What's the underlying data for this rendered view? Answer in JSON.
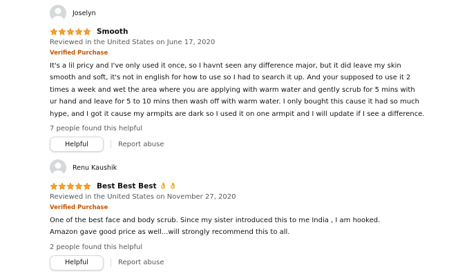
{
  "reviews": [
    {
      "author": "Joselyn",
      "rating": 5,
      "title": "Smooth",
      "title_emoji": "",
      "meta": "Reviewed in the United States on June 17, 2020",
      "verified": "Verified Purchase",
      "body": "It's a lil pricy and I've only used it once, so I havnt seen any difference major, but it did leave my skin\nsmooth and soft, it's not in english for how to use so I had to search it up. And your supposed to use it 2\ntimes a week and wet the area where you are applying with warm water and gently scrub for 5 mins with\nur hand and leave for 5 to 10 mins then wash off with warm water. I only bought this cause it had so much\nhype, and I got it cause my armpits are dark so I used it on one armpit and I will update if I see a difference.",
      "helpful_count": "7 people found this helpful",
      "helpful_label": "Helpful",
      "report_label": "Report abuse"
    },
    {
      "author": "Renu Kaushik",
      "rating": 5,
      "title": "Best Best Best",
      "title_emoji": "👌 👌",
      "meta": "Reviewed in the United States on November 27, 2020",
      "verified": "Verified Purchase",
      "body": "One of the best face and body scrub. Since my sister introduced this to me India , I am hooked.\nAmazon gave good price as well...will strongly recommend this to all.",
      "helpful_count": "2 people found this helpful",
      "helpful_label": "Helpful",
      "report_label": "Report abuse"
    }
  ],
  "colors": {
    "star": "#f7a21c",
    "verified": "#c45500",
    "meta": "#565959"
  }
}
